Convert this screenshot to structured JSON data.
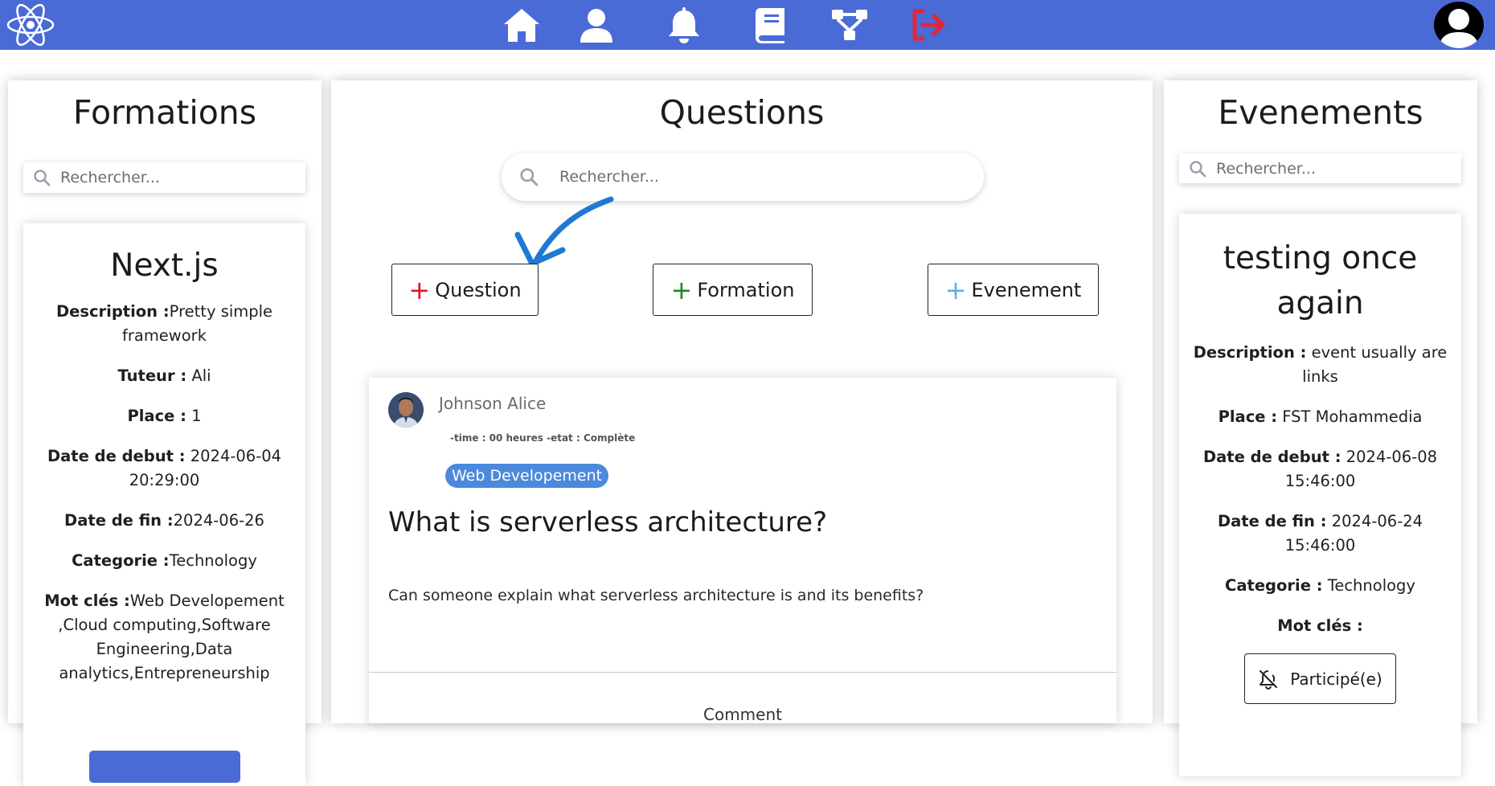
{
  "nav": {
    "icons": [
      "atom-logo-icon",
      "home-icon",
      "user-icon",
      "bell-icon",
      "book-icon",
      "sitemap-icon",
      "logout-icon",
      "user-avatar-icon"
    ],
    "colors": {
      "bar": "#4a6ad6",
      "logout": "#e32636",
      "white": "#ffffff"
    }
  },
  "left": {
    "title": "Formations",
    "search_placeholder": "Rechercher...",
    "card": {
      "title": "Next.js",
      "description_label": "Description :",
      "description": "Pretty simple framework",
      "tuteur_label": "Tuteur :",
      "tuteur": " Ali",
      "place_label": "Place :",
      "place": " 1",
      "debut_label": "Date de debut :",
      "debut": " 2024-06-04 20:29:00",
      "fin_label": "Date de fin :",
      "fin": "2024-06-26",
      "categorie_label": "Categorie :",
      "categorie": "Technology",
      "motcles_label": "Mot clés :",
      "motcles": "Web Developement ,Cloud computing,Software Engineering,Data analytics,Entrepreneurship"
    }
  },
  "middle": {
    "title": "Questions",
    "search_placeholder": "Rechercher...",
    "buttons": {
      "question": "Question",
      "formation": "Formation",
      "evenement": "Evenement"
    },
    "plus_colors": {
      "question": "#e0141e",
      "formation": "#1a8a1a",
      "evenement": "#5aaee8"
    },
    "post": {
      "author": "Johnson Alice",
      "meta": "-time : 00 heures -etat : Complète",
      "tag": "Web Developement",
      "title": "What is serverless architecture?",
      "body": "Can someone explain what serverless architecture is and its benefits?",
      "footer": "Comment"
    }
  },
  "right": {
    "title": "Evenements",
    "search_placeholder": "Rechercher...",
    "card": {
      "title": "testing once again",
      "description_label": "Description :",
      "description": " event usually are links",
      "place_label": "Place :",
      "place": " FST Mohammedia",
      "debut_label": "Date de debut :",
      "debut": " 2024-06-08 15:46:00",
      "fin_label": "Date de fin :",
      "fin": " 2024-06-24 15:46:00",
      "categorie_label": "Categorie :",
      "categorie": " Technology",
      "motcles_label": "Mot clés :",
      "participe_label": "Participé(e)"
    }
  }
}
